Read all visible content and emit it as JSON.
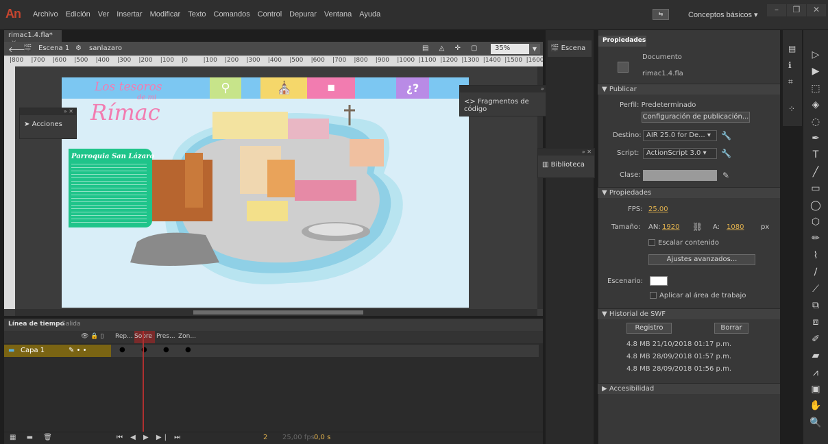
{
  "app": {
    "logo": "An"
  },
  "menu": [
    "Archivo",
    "Edición",
    "Ver",
    "Insertar",
    "Modificar",
    "Texto",
    "Comandos",
    "Control",
    "Depurar",
    "Ventana",
    "Ayuda"
  ],
  "workspace": {
    "label": "Conceptos básicos ▾"
  },
  "document": {
    "tab": "rimac1.4.fla*",
    "scene": "Escena 1",
    "symbol": "sanlazaro",
    "zoom": "35%",
    "ruler_h": [
      "800",
      "700",
      "600",
      "500",
      "400",
      "300",
      "200",
      "100",
      "0",
      "100",
      "200",
      "300",
      "400",
      "500",
      "600",
      "700",
      "800",
      "900",
      "1000",
      "1100",
      "1200",
      "1300",
      "1400",
      "1500",
      "1600"
    ]
  },
  "stage_content": {
    "title_line1": "Los tesoros",
    "title_line2": "de mi",
    "title_line3": "Rímac",
    "card_title": "Parroquia San Lázaro",
    "nav_q": "¿?"
  },
  "floating": {
    "acciones": "Acciones",
    "fragmentos": "Fragmentos de código",
    "escena": "Escena",
    "biblioteca": "Biblioteca"
  },
  "timeline": {
    "tabs": [
      "Línea de tiempo",
      "Salida"
    ],
    "layer": "Capa 1",
    "frame_labels": [
      "Rep...",
      "Sobre",
      "Pres...",
      "Zon..."
    ],
    "bottom_frame": "2",
    "fps": "25,00 fps",
    "time": "0,0 s"
  },
  "properties": {
    "tab": "Propiedades",
    "doc_type": "Documento",
    "doc_name": "rimac1.4.fla",
    "publish_section": "Publicar",
    "profile": "Perfil: Predeterminado",
    "publish_settings": "Configuración de publicación...",
    "target_label": "Destino:",
    "target_value": "AIR 25.0 for De...",
    "script_label": "Script:",
    "script_value": "ActionScript 3.0",
    "class_label": "Clase:",
    "props_section": "Propiedades",
    "fps_label": "FPS:",
    "fps_value": "25.00",
    "size_label": "Tamaño:",
    "w_label": "AN:",
    "w_value": "1920",
    "h_label": "A:",
    "h_value": "1080",
    "unit": "px",
    "scale_content": "Escalar contenido",
    "advanced": "Ajustes avanzados...",
    "stage_label": "Escenario:",
    "apply_stage": "Aplicar al área de trabajo",
    "swf_section": "Historial de SWF",
    "log_btn": "Registro",
    "clear_btn": "Borrar",
    "swf_history": [
      {
        "size": "4.8 MB",
        "date": "21/10/2018 01:17 p.m."
      },
      {
        "size": "4.8 MB",
        "date": "28/09/2018 01:57 p.m."
      },
      {
        "size": "4.8 MB",
        "date": "28/09/2018 01:56 p.m."
      }
    ],
    "access_section": "Accesibilidad"
  },
  "colors": {
    "accent": "#e2b24e",
    "layer": "#7a6413",
    "stage_bg": "#d9eef8",
    "nav_blue": "#7cc7f2",
    "nav_green": "#c7e48a",
    "nav_yellow": "#f5d76a",
    "nav_pink": "#f27cb0",
    "nav_purple": "#b98be6",
    "card_green": "#1fc48a"
  }
}
